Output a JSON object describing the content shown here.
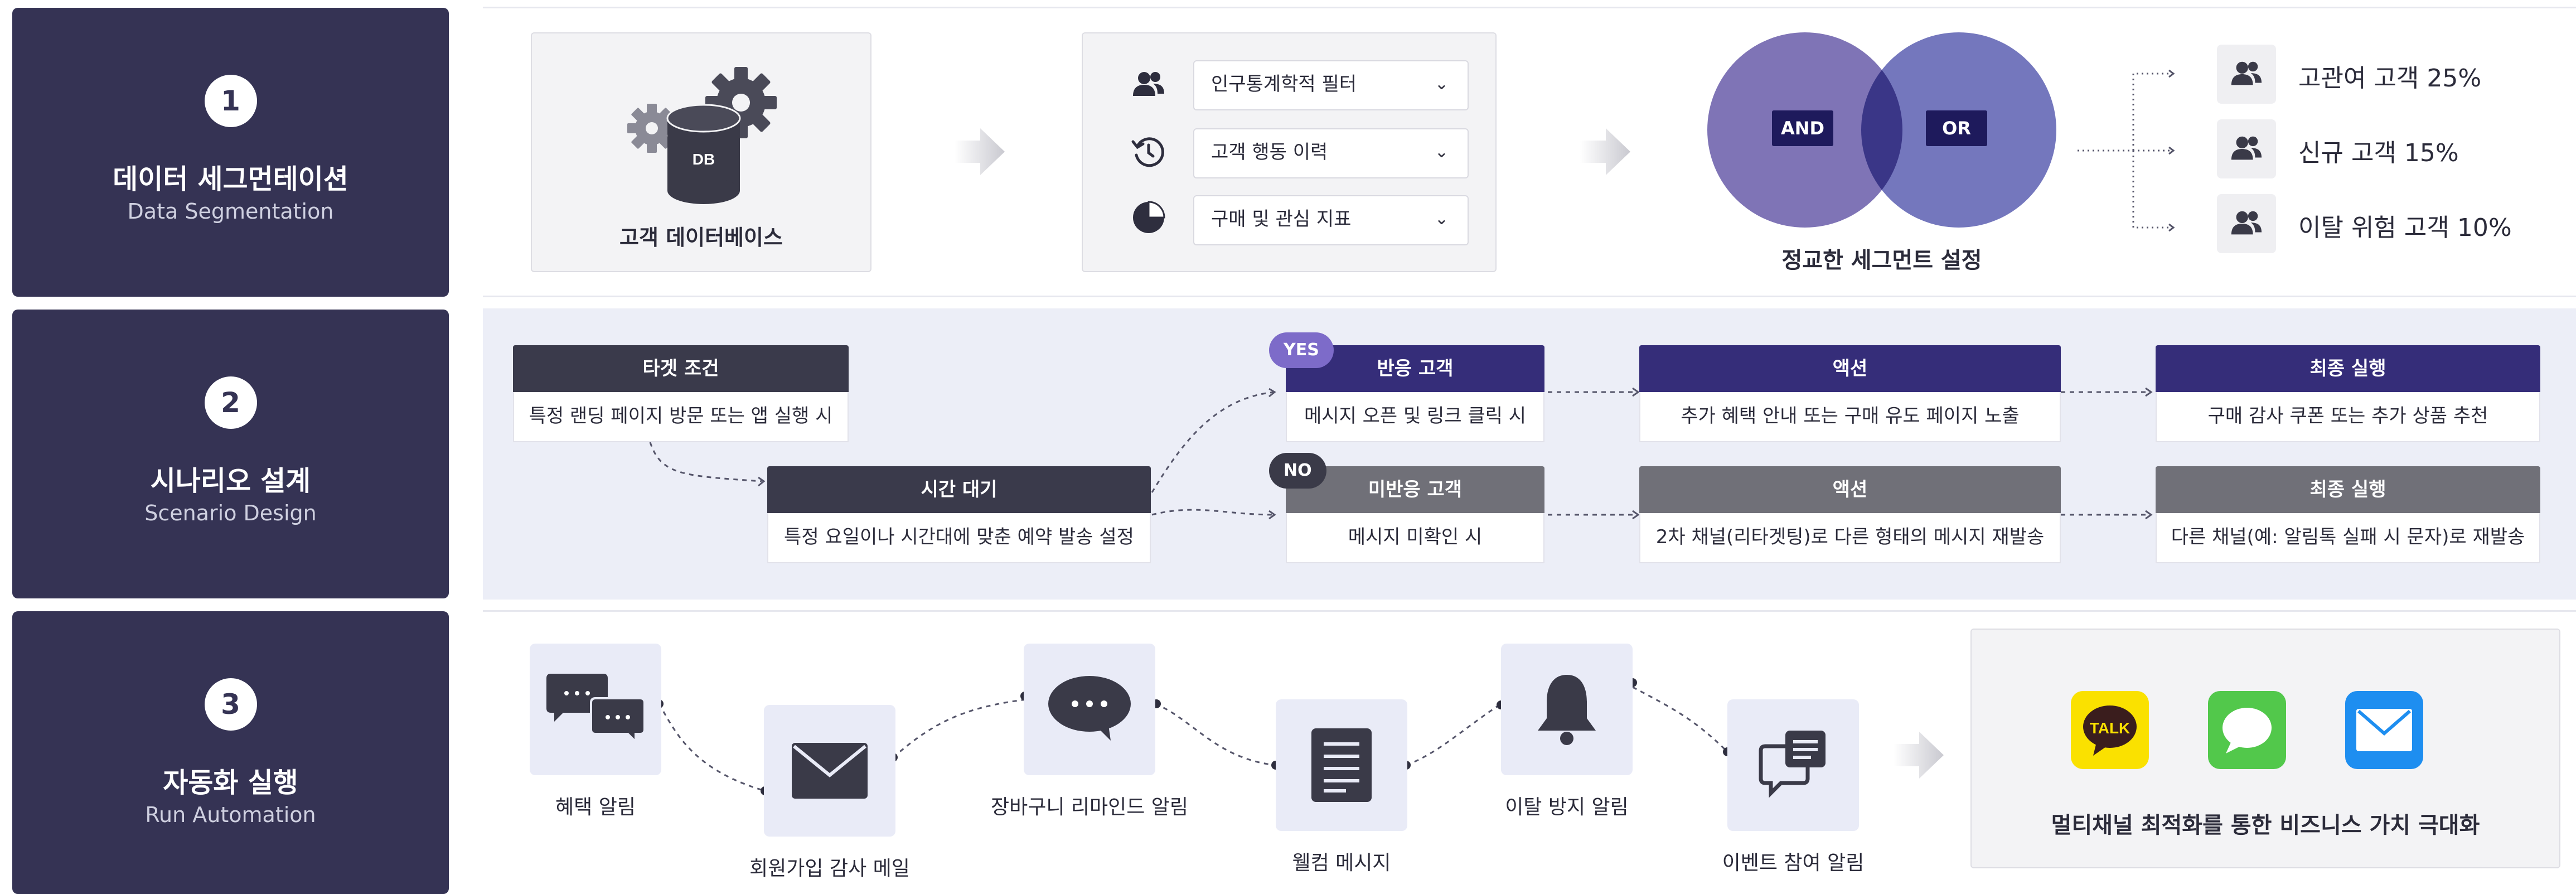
{
  "steps": [
    {
      "num": "1",
      "title": "데이터 세그먼테이션",
      "subtitle": "Data Segmentation"
    },
    {
      "num": "2",
      "title": "시나리오 설계",
      "subtitle": "Scenario Design"
    },
    {
      "num": "3",
      "title": "자동화 실행",
      "subtitle": "Run Automation"
    }
  ],
  "row1": {
    "db_icon_label": "DB",
    "db_caption": "고객 데이터베이스",
    "filters": [
      {
        "label": "인구통계학적 필터",
        "icon": "users-icon"
      },
      {
        "label": "고객 행동 이력",
        "icon": "history-icon"
      },
      {
        "label": "구매 및 관심 지표",
        "icon": "pie-chart-icon"
      }
    ],
    "venn": {
      "left_tag": "AND",
      "right_tag": "OR",
      "caption": "정교한 세그먼트 설정",
      "left_color": "#7f74b6",
      "right_color": "#6c70ba"
    },
    "segments": [
      "고관여 고객 25%",
      "신규 고객 15%",
      "이탈 위험 고객 10%"
    ]
  },
  "row2": {
    "target": {
      "header": "타겟 조건",
      "body": "특정 랜딩 페이지 방문 또는 앱 실행 시"
    },
    "wait": {
      "header": "시간 대기",
      "body": "특정 요일이나 시간대에 맞춘 예약 발송 설정"
    },
    "yes_pill": "YES",
    "no_pill": "NO",
    "responded": {
      "header": "반응 고객",
      "body": "메시지 오픈 및 링크 클릭 시"
    },
    "unresponded": {
      "header": "미반응 고객",
      "body": "메시지 미확인 시"
    },
    "action_yes": {
      "header": "액션",
      "body": "추가 혜택 안내 또는 구매 유도 페이지 노출"
    },
    "action_no": {
      "header": "액션",
      "body": "2차 채널(리타겟팅)로 다른 형태의 메시지 재발송"
    },
    "final_yes": {
      "header": "최종 실행",
      "body": "구매 감사 쿠폰 또는 추가 상품 추천"
    },
    "final_no": {
      "header": "최종 실행",
      "body": "다른 채널(예: 알림톡 실패 시 문자)로 재발송"
    },
    "colors": {
      "dark": "#3a3a4b",
      "purple": "#352d79",
      "gray": "#707078"
    }
  },
  "row3": {
    "items": [
      {
        "label": "혜택 알림",
        "icon": "chat-bubbles-icon"
      },
      {
        "label": "회원가입 감사 메일",
        "icon": "envelope-icon"
      },
      {
        "label": "장바구니 리마인드 알림",
        "icon": "speech-bubble-icon"
      },
      {
        "label": "웰컴 메시지",
        "icon": "document-icon"
      },
      {
        "label": "이탈 방지 알림",
        "icon": "bell-icon"
      },
      {
        "label": "이벤트 참여 알림",
        "icon": "message-list-icon"
      }
    ],
    "channels": [
      {
        "name": "kakaotalk-app-icon",
        "text": "TALK",
        "color": "#fae100"
      },
      {
        "name": "messages-app-icon",
        "color": "#52c84b"
      },
      {
        "name": "mail-app-icon",
        "color": "#1e8ef0"
      }
    ],
    "channels_caption": "멀티채널 최적화를 통한 비즈니스 가치 극대화"
  }
}
